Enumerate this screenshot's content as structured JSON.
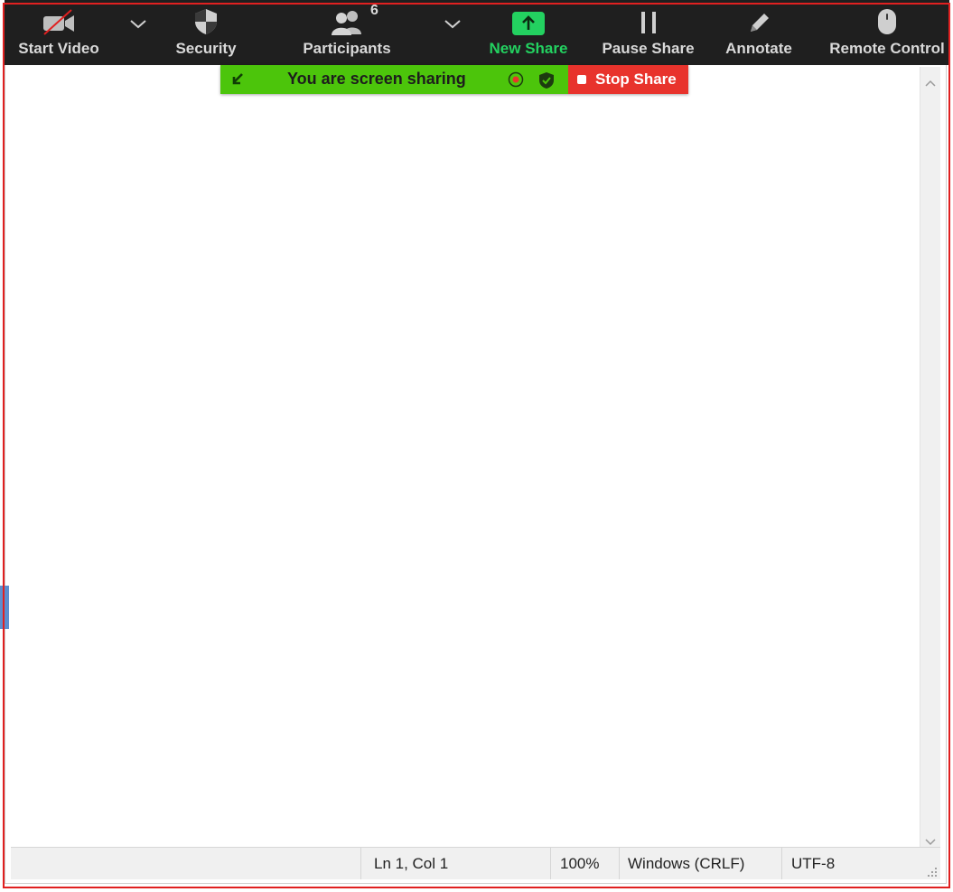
{
  "toolbar": {
    "start_video": "Start Video",
    "security": "Security",
    "participants": "Participants",
    "participants_count": "6",
    "new_share": "New Share",
    "pause_share": "Pause Share",
    "annotate": "Annotate",
    "remote_control": "Remote Control"
  },
  "banner": {
    "sharing_text": "You are screen sharing",
    "stop_share": "Stop Share"
  },
  "statusbar": {
    "position": "Ln 1, Col 1",
    "zoom": "100%",
    "line_endings": "Windows (CRLF)",
    "encoding": "UTF-8"
  },
  "colors": {
    "toolbar_bg": "#1f1f1f",
    "new_share_green": "#23d160",
    "banner_green": "#4cc50b",
    "stop_red": "#e8332c",
    "frame_red": "#e02020"
  }
}
